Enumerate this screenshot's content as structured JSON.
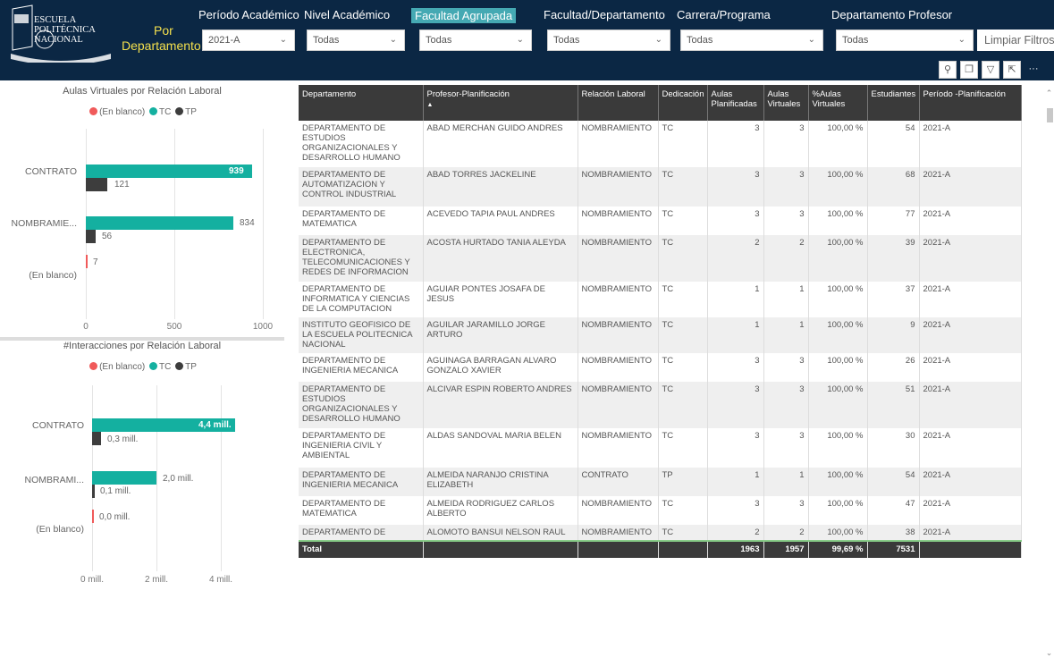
{
  "header": {
    "logo": {
      "line1": "ESCUELA",
      "line2": "POLITÉCNICA",
      "line3": "NACIONAL"
    },
    "por_label": "Por",
    "dept_label": "Departamento",
    "filters": [
      {
        "label": "Período Académico",
        "value": "2021-A"
      },
      {
        "label": "Nivel Académico",
        "value": "Todas"
      },
      {
        "label": "Facultad Agrupada",
        "value": "Todas"
      },
      {
        "label": "Facultad/Departamento",
        "value": "Todas"
      },
      {
        "label": "Carrera/Programa",
        "value": "Todas"
      },
      {
        "label": "Departamento Profesor",
        "value": "Todas"
      }
    ],
    "clear_button": "Limpiar Filtros",
    "toolbar_icons": [
      "pin-icon",
      "copy-icon",
      "filter-icon",
      "focus-mode-icon",
      "more-options-icon"
    ]
  },
  "colors": {
    "header_bg": "#0b2744",
    "tc": "#14b0a0",
    "tp": "#3d3d3d",
    "blank": "#f05a5a",
    "highlight_label": "#f4e04d",
    "active_filter": "#45a9b3"
  },
  "chart1": {
    "title": "Aulas Virtuales por Relación Laboral",
    "legend": [
      "(En blanco)",
      "TC",
      "TP"
    ],
    "categories": [
      "CONTRATO",
      "NOMBRAMIE...",
      "(En blanco)"
    ],
    "tc_labels": [
      "939",
      "834",
      ""
    ],
    "tp_labels": [
      "121",
      "56",
      ""
    ],
    "blank_labels": [
      "",
      "",
      "7"
    ],
    "ticks": [
      "0",
      "500",
      "1000"
    ]
  },
  "chart2": {
    "title": "#Interacciones por Relación Laboral",
    "legend": [
      "(En blanco)",
      "TC",
      "TP"
    ],
    "categories": [
      "CONTRATO",
      "NOMBRAMI...",
      "(En blanco)"
    ],
    "tc_labels": [
      "4,4 mill.",
      "2,0 mill.",
      ""
    ],
    "tp_labels": [
      "0,3 mill.",
      "0,1 mill.",
      ""
    ],
    "blank_labels": [
      "",
      "",
      "0,0 mill."
    ],
    "ticks": [
      "0 mill.",
      "2 mill.",
      "4 mill."
    ]
  },
  "chart_data": [
    {
      "type": "bar",
      "title": "Aulas Virtuales por Relación Laboral",
      "categories": [
        "CONTRATO",
        "NOMBRAMIE...",
        "(En blanco)"
      ],
      "series": [
        {
          "name": "(En blanco)",
          "values": [
            0,
            0,
            7
          ]
        },
        {
          "name": "TC",
          "values": [
            939,
            834,
            0
          ]
        },
        {
          "name": "TP",
          "values": [
            121,
            56,
            0
          ]
        }
      ],
      "xlim": [
        0,
        1000
      ],
      "orientation": "horizontal"
    },
    {
      "type": "bar",
      "title": "#Interacciones por Relación Laboral",
      "categories": [
        "CONTRATO",
        "NOMBRAMI...",
        "(En blanco)"
      ],
      "series": [
        {
          "name": "(En blanco)",
          "values": [
            0,
            0,
            0.0
          ]
        },
        {
          "name": "TC",
          "values": [
            4.4,
            2.0,
            0
          ]
        },
        {
          "name": "TP",
          "values": [
            0.3,
            0.1,
            0
          ]
        }
      ],
      "xlim": [
        0,
        4
      ],
      "orientation": "horizontal"
    }
  ],
  "table": {
    "headers": [
      "Departamento",
      "Profesor-Planificación",
      "Relación Laboral",
      "Dedicación",
      "Aulas Planificadas",
      "Aulas Virtuales",
      "%Aulas Virtuales",
      "Estudiantes",
      "Período -Planificación"
    ],
    "sort_indicator": "▲",
    "rows": [
      [
        "DEPARTAMENTO DE ESTUDIOS ORGANIZACIONALES Y DESARROLLO HUMANO",
        "ABAD MERCHAN GUIDO ANDRES",
        "NOMBRAMIENTO",
        "TC",
        "3",
        "3",
        "100,00 %",
        "54",
        "2021-A"
      ],
      [
        "DEPARTAMENTO DE AUTOMATIZACION Y CONTROL INDUSTRIAL",
        "ABAD TORRES JACKELINE",
        "NOMBRAMIENTO",
        "TC",
        "3",
        "3",
        "100,00 %",
        "68",
        "2021-A"
      ],
      [
        "DEPARTAMENTO DE MATEMATICA",
        "ACEVEDO TAPIA PAUL ANDRES",
        "NOMBRAMIENTO",
        "TC",
        "3",
        "3",
        "100,00 %",
        "77",
        "2021-A"
      ],
      [
        "DEPARTAMENTO DE ELECTRONICA, TELECOMUNICACIONES Y REDES DE INFORMACION",
        "ACOSTA HURTADO TANIA ALEYDA",
        "NOMBRAMIENTO",
        "TC",
        "2",
        "2",
        "100,00 %",
        "39",
        "2021-A"
      ],
      [
        "DEPARTAMENTO DE INFORMATICA Y CIENCIAS DE LA COMPUTACION",
        "AGUIAR PONTES JOSAFA DE JESUS",
        "NOMBRAMIENTO",
        "TC",
        "1",
        "1",
        "100,00 %",
        "37",
        "2021-A"
      ],
      [
        "INSTITUTO GEOFISICO DE LA ESCUELA POLITECNICA NACIONAL",
        "AGUILAR JARAMILLO JORGE ARTURO",
        "NOMBRAMIENTO",
        "TC",
        "1",
        "1",
        "100,00 %",
        "9",
        "2021-A"
      ],
      [
        "DEPARTAMENTO DE INGENIERIA MECANICA",
        "AGUINAGA BARRAGAN ALVARO GONZALO XAVIER",
        "NOMBRAMIENTO",
        "TC",
        "3",
        "3",
        "100,00 %",
        "26",
        "2021-A"
      ],
      [
        "DEPARTAMENTO DE ESTUDIOS ORGANIZACIONALES Y DESARROLLO HUMANO",
        "ALCIVAR ESPIN ROBERTO ANDRES",
        "NOMBRAMIENTO",
        "TC",
        "3",
        "3",
        "100,00 %",
        "51",
        "2021-A"
      ],
      [
        "DEPARTAMENTO DE INGENIERIA CIVIL Y AMBIENTAL",
        "ALDAS SANDOVAL MARIA BELEN",
        "NOMBRAMIENTO",
        "TC",
        "3",
        "3",
        "100,00 %",
        "30",
        "2021-A"
      ],
      [
        "DEPARTAMENTO DE INGENIERIA MECANICA",
        "ALMEIDA NARANJO CRISTINA ELIZABETH",
        "CONTRATO",
        "TP",
        "1",
        "1",
        "100,00 %",
        "54",
        "2021-A"
      ],
      [
        "DEPARTAMENTO DE MATEMATICA",
        "ALMEIDA RODRIGUEZ CARLOS ALBERTO",
        "NOMBRAMIENTO",
        "TC",
        "3",
        "3",
        "100,00 %",
        "47",
        "2021-A"
      ],
      [
        "DEPARTAMENTO DE",
        "ALOMOTO BANSUI NELSON RAUL",
        "NOMBRAMIENTO",
        "TC",
        "2",
        "2",
        "100,00 %",
        "38",
        "2021-A"
      ]
    ],
    "total": [
      "Total",
      "",
      "",
      "",
      "1963",
      "1957",
      "99,69 %",
      "7531",
      ""
    ]
  }
}
